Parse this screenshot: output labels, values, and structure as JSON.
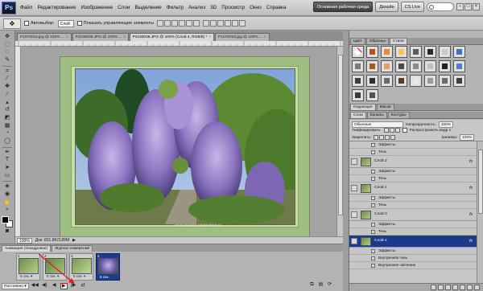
{
  "app": {
    "logo": "Ps",
    "menu": [
      "Файл",
      "Редактирование",
      "Изображение",
      "Слои",
      "Выделение",
      "Фильтр",
      "Анализ",
      "3D",
      "Просмотр",
      "Окно",
      "Справка"
    ],
    "workspace_button": "Основная рабочая среда",
    "design_button": "Дизайн",
    "cslive_label": "CS Live",
    "window_controls": [
      "–",
      "□",
      "×"
    ]
  },
  "options": {
    "autoselect_label": "Автовыбор:",
    "autoselect_value": "Слой",
    "show_controls_label": "Показать управляющие элементы"
  },
  "doc_tabs": [
    {
      "label": "P1070015.jpg @ 100% ...",
      "active": false
    },
    {
      "label": "P4230035.JPG @ 100% ...",
      "active": false
    },
    {
      "label": "P4230038.JPG @ 100% (Слой 4, RGB/8) *",
      "active": true
    },
    {
      "label": "P1070023.jpg @ 100% ...",
      "active": false
    }
  ],
  "status": {
    "zoom": "100%",
    "doc_size": "Док: 831,8K/3,89M"
  },
  "canvas": {
    "watermark": "www.master-photoshop.ru"
  },
  "animation": {
    "tabs": [
      {
        "label": "Анимация (покадровая)",
        "active": true
      },
      {
        "label": "Журнал измерений",
        "active": false
      }
    ],
    "frames": [
      {
        "num": "1",
        "delay": "5 сек. ▾",
        "selected": false
      },
      {
        "num": "2",
        "delay": "5 сек. ▾",
        "selected": false
      },
      {
        "num": "3",
        "delay": "5 сек. ▾",
        "selected": false
      },
      {
        "num": "4",
        "delay": "5 сек.",
        "selected": true
      }
    ],
    "loop_value": "Постоянно ▾",
    "controls": [
      "◀◀",
      "◀|",
      "◀",
      "▶",
      "|▶",
      "⇄"
    ],
    "right_controls": [
      "⧉",
      "▤",
      "⟳"
    ]
  },
  "right": {
    "top_tabs": [
      {
        "label": "Цвет",
        "active": false
      },
      {
        "label": "Образцы",
        "active": false
      },
      {
        "label": "Стили",
        "active": true
      }
    ],
    "style_colors": [
      "#ffffff",
      "#e03a2a",
      "#f08a30",
      "#f5c842",
      "#5d5d5d",
      "#2a2a2a",
      "#c9c9c9",
      "#3d6fd1",
      "#7a7a7a",
      "#a35a2a",
      "#d9a55a",
      "#4a4a4a",
      "#8a8a8a",
      "#c0c0c0",
      "#1f1f1f",
      "#4e7bd6",
      "#3e3e3e",
      "#2e2e2e",
      "#6b6b6b",
      "#5a3a22",
      "#e8e8e8",
      "#9b9b9b",
      "#6c6c6c",
      "#3f3f3f",
      "#383838",
      "#505050"
    ],
    "corr_tabs": [
      {
        "label": "Коррекция",
        "active": true
      },
      {
        "label": "Маски",
        "active": false
      }
    ],
    "layer_tabs": [
      {
        "label": "Слои",
        "active": true
      },
      {
        "label": "Каналы",
        "active": false
      },
      {
        "label": "Контуры",
        "active": false
      }
    ],
    "blend_mode": "Обычные",
    "opacity_label": "Непрозрачность:",
    "opacity_value": "100%",
    "unify_label": "Унифицировать:",
    "propagate_label": "Распространить кадр 1",
    "lock_label": "Закрепить:",
    "fill_label": "Заливка:",
    "fill_value": "100%",
    "layers": [
      {
        "type": "sub",
        "name": "Эффекты"
      },
      {
        "type": "sub",
        "name": "Тень"
      },
      {
        "type": "layer",
        "name": "Слой 2",
        "fx": "fx",
        "selected": false
      },
      {
        "type": "sub",
        "name": "Эффекты"
      },
      {
        "type": "sub",
        "name": "Тень"
      },
      {
        "type": "layer",
        "name": "Слой 1",
        "fx": "fx",
        "selected": false
      },
      {
        "type": "sub",
        "name": "Эффекты"
      },
      {
        "type": "sub",
        "name": "Тень"
      },
      {
        "type": "layer",
        "name": "Слой 0",
        "fx": "fx",
        "selected": false
      },
      {
        "type": "sub",
        "name": "Эффекты"
      },
      {
        "type": "sub",
        "name": "Тень"
      },
      {
        "type": "layer",
        "name": "Слой 4",
        "fx": "fx",
        "selected": true
      },
      {
        "type": "sub",
        "name": "Эффекты"
      },
      {
        "type": "sub",
        "name": "Внутренняя тень"
      },
      {
        "type": "sub",
        "name": "Внутреннее свечение"
      }
    ]
  }
}
